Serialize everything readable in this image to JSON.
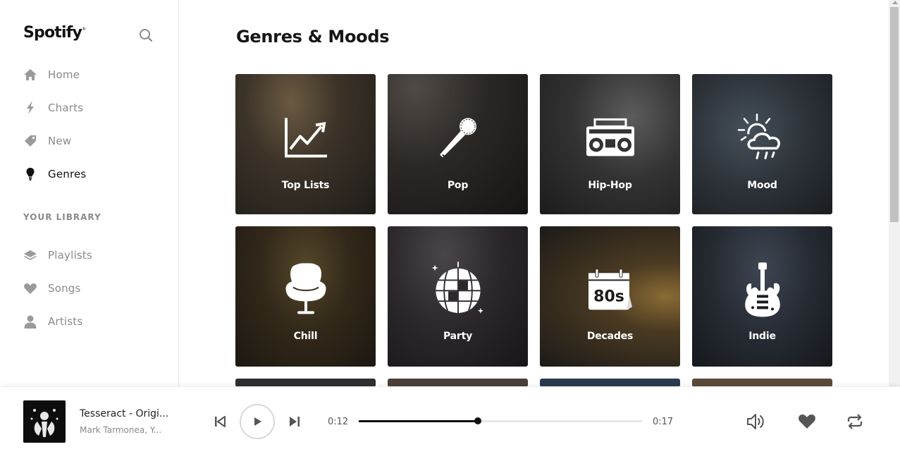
{
  "app": {
    "logo": "Spotify",
    "logo_mark": "®"
  },
  "sidebar": {
    "nav": [
      {
        "label": "Home",
        "icon": "home-icon",
        "active": false
      },
      {
        "label": "Charts",
        "icon": "bolt-icon",
        "active": false
      },
      {
        "label": "New",
        "icon": "tag-icon",
        "active": false
      },
      {
        "label": "Genres",
        "icon": "lightbulb-icon",
        "active": true
      }
    ],
    "library_label": "YOUR LIBRARY",
    "library": [
      {
        "label": "Playlists",
        "icon": "layers-icon"
      },
      {
        "label": "Songs",
        "icon": "heart-icon"
      },
      {
        "label": "Artists",
        "icon": "user-icon"
      }
    ]
  },
  "main": {
    "title": "Genres & Moods",
    "tiles": [
      {
        "label": "Top Lists",
        "icon": "chart-trend-icon"
      },
      {
        "label": "Pop",
        "icon": "microphone-icon"
      },
      {
        "label": "Hip-Hop",
        "icon": "boombox-icon"
      },
      {
        "label": "Mood",
        "icon": "sun-cloud-rain-icon"
      },
      {
        "label": "Chill",
        "icon": "egg-chair-icon"
      },
      {
        "label": "Party",
        "icon": "disco-ball-icon"
      },
      {
        "label": "Decades",
        "icon": "calendar-80s-icon",
        "icon_text": "80s"
      },
      {
        "label": "Indie",
        "icon": "electric-guitar-icon"
      }
    ]
  },
  "player": {
    "track_title": "Tesseract - Origi...",
    "track_artist": "Mark Tarmonea, Y...",
    "time_current": "0:12",
    "time_total": "0:17",
    "progress": 0.42,
    "colors": {
      "accent": "#111111",
      "muted": "#8a8a8a"
    }
  }
}
